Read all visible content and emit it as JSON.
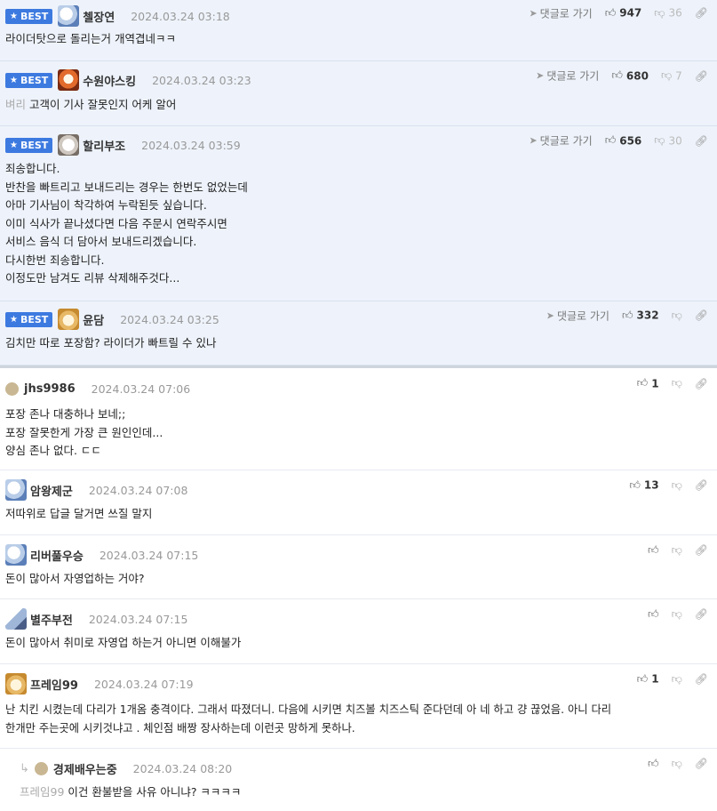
{
  "labels": {
    "best": "BEST",
    "goto": "댓글로 가기"
  },
  "icons": {
    "star": "★",
    "thumbs_up": "👍",
    "thumbs_down": "👎",
    "link": "🔗",
    "arrow": "➤",
    "reply": "↳"
  },
  "colors": {
    "accent": "#3d7ae0",
    "best_bg": "#eef3fb"
  },
  "best_comments": [
    {
      "nick": "첼장연",
      "date": "2024.03.24 03:18",
      "up": "947",
      "down": "36",
      "lines": [
        "라이더탓으로 돌리는거 개역겹네ㅋㅋ"
      ]
    },
    {
      "nick": "수원야스킹",
      "date": "2024.03.24 03:23",
      "up": "680",
      "down": "7",
      "mention": "벼리",
      "lines": [
        "고객이 기사 잘못인지 어케 알어"
      ]
    },
    {
      "nick": "할리부조",
      "date": "2024.03.24 03:59",
      "up": "656",
      "down": "30",
      "lines": [
        "죄송합니다.",
        "반찬을 빠트리고 보내드리는 경우는 한번도 없었는데",
        "아마 기사님이 착각하여 누락된듯 싶습니다.",
        "이미 식사가 끝나셨다면 다음 주문시 연락주시면",
        "서비스 음식 더 담아서 보내드리겠습니다.",
        "다시한번 죄송합니다.",
        "이정도만 남겨도 리뷰 삭제해주것다..."
      ]
    },
    {
      "nick": "윤담",
      "date": "2024.03.24 03:25",
      "up": "332",
      "down": "",
      "lines": [
        "김치만 따로 포장함? 라이더가 빠트릴 수 있나"
      ]
    }
  ],
  "comments": [
    {
      "nick": "jhs9986",
      "date": "2024.03.24 07:06",
      "up": "1",
      "lines": [
        "포장 존나 대충하나 보네;;",
        "포장 잘못한게 가장 큰 원인인데...",
        "양심 존나 없다. ㄷㄷ"
      ]
    },
    {
      "nick": "암왕제군",
      "date": "2024.03.24 07:08",
      "up": "13",
      "lines": [
        "저따위로 답글 달거면 쓰질 말지"
      ]
    },
    {
      "nick": "리버풀우승",
      "date": "2024.03.24 07:15",
      "up": "",
      "lines": [
        "돈이 많아서 자영업하는 거야?"
      ]
    },
    {
      "nick": "별주부전",
      "date": "2024.03.24 07:15",
      "up": "",
      "lines": [
        "돈이 많아서 취미로 자영업 하는거 아니면 이해불가"
      ]
    },
    {
      "nick": "프레임99",
      "date": "2024.03.24 07:19",
      "up": "1",
      "lines": [
        "난 치킨 시켰는데 다리가 1개옴 충격이다. 그래서 따졌더니. 다음에 시키면 치즈볼 치즈스틱 준다던데 아 네 하고 걍 끊었음. 아니 다리",
        "한개만 주는곳에 시키것냐고 . 체인점 배짱 장사하는데 이런곳 망하게 못하나."
      ]
    }
  ],
  "reply": {
    "nick": "경제배우는중",
    "date": "2024.03.24 08:20",
    "up": "",
    "mention": "프레임99",
    "text": "이건 환불받을 사유 아니냐? ㅋㅋㅋㅋ"
  }
}
